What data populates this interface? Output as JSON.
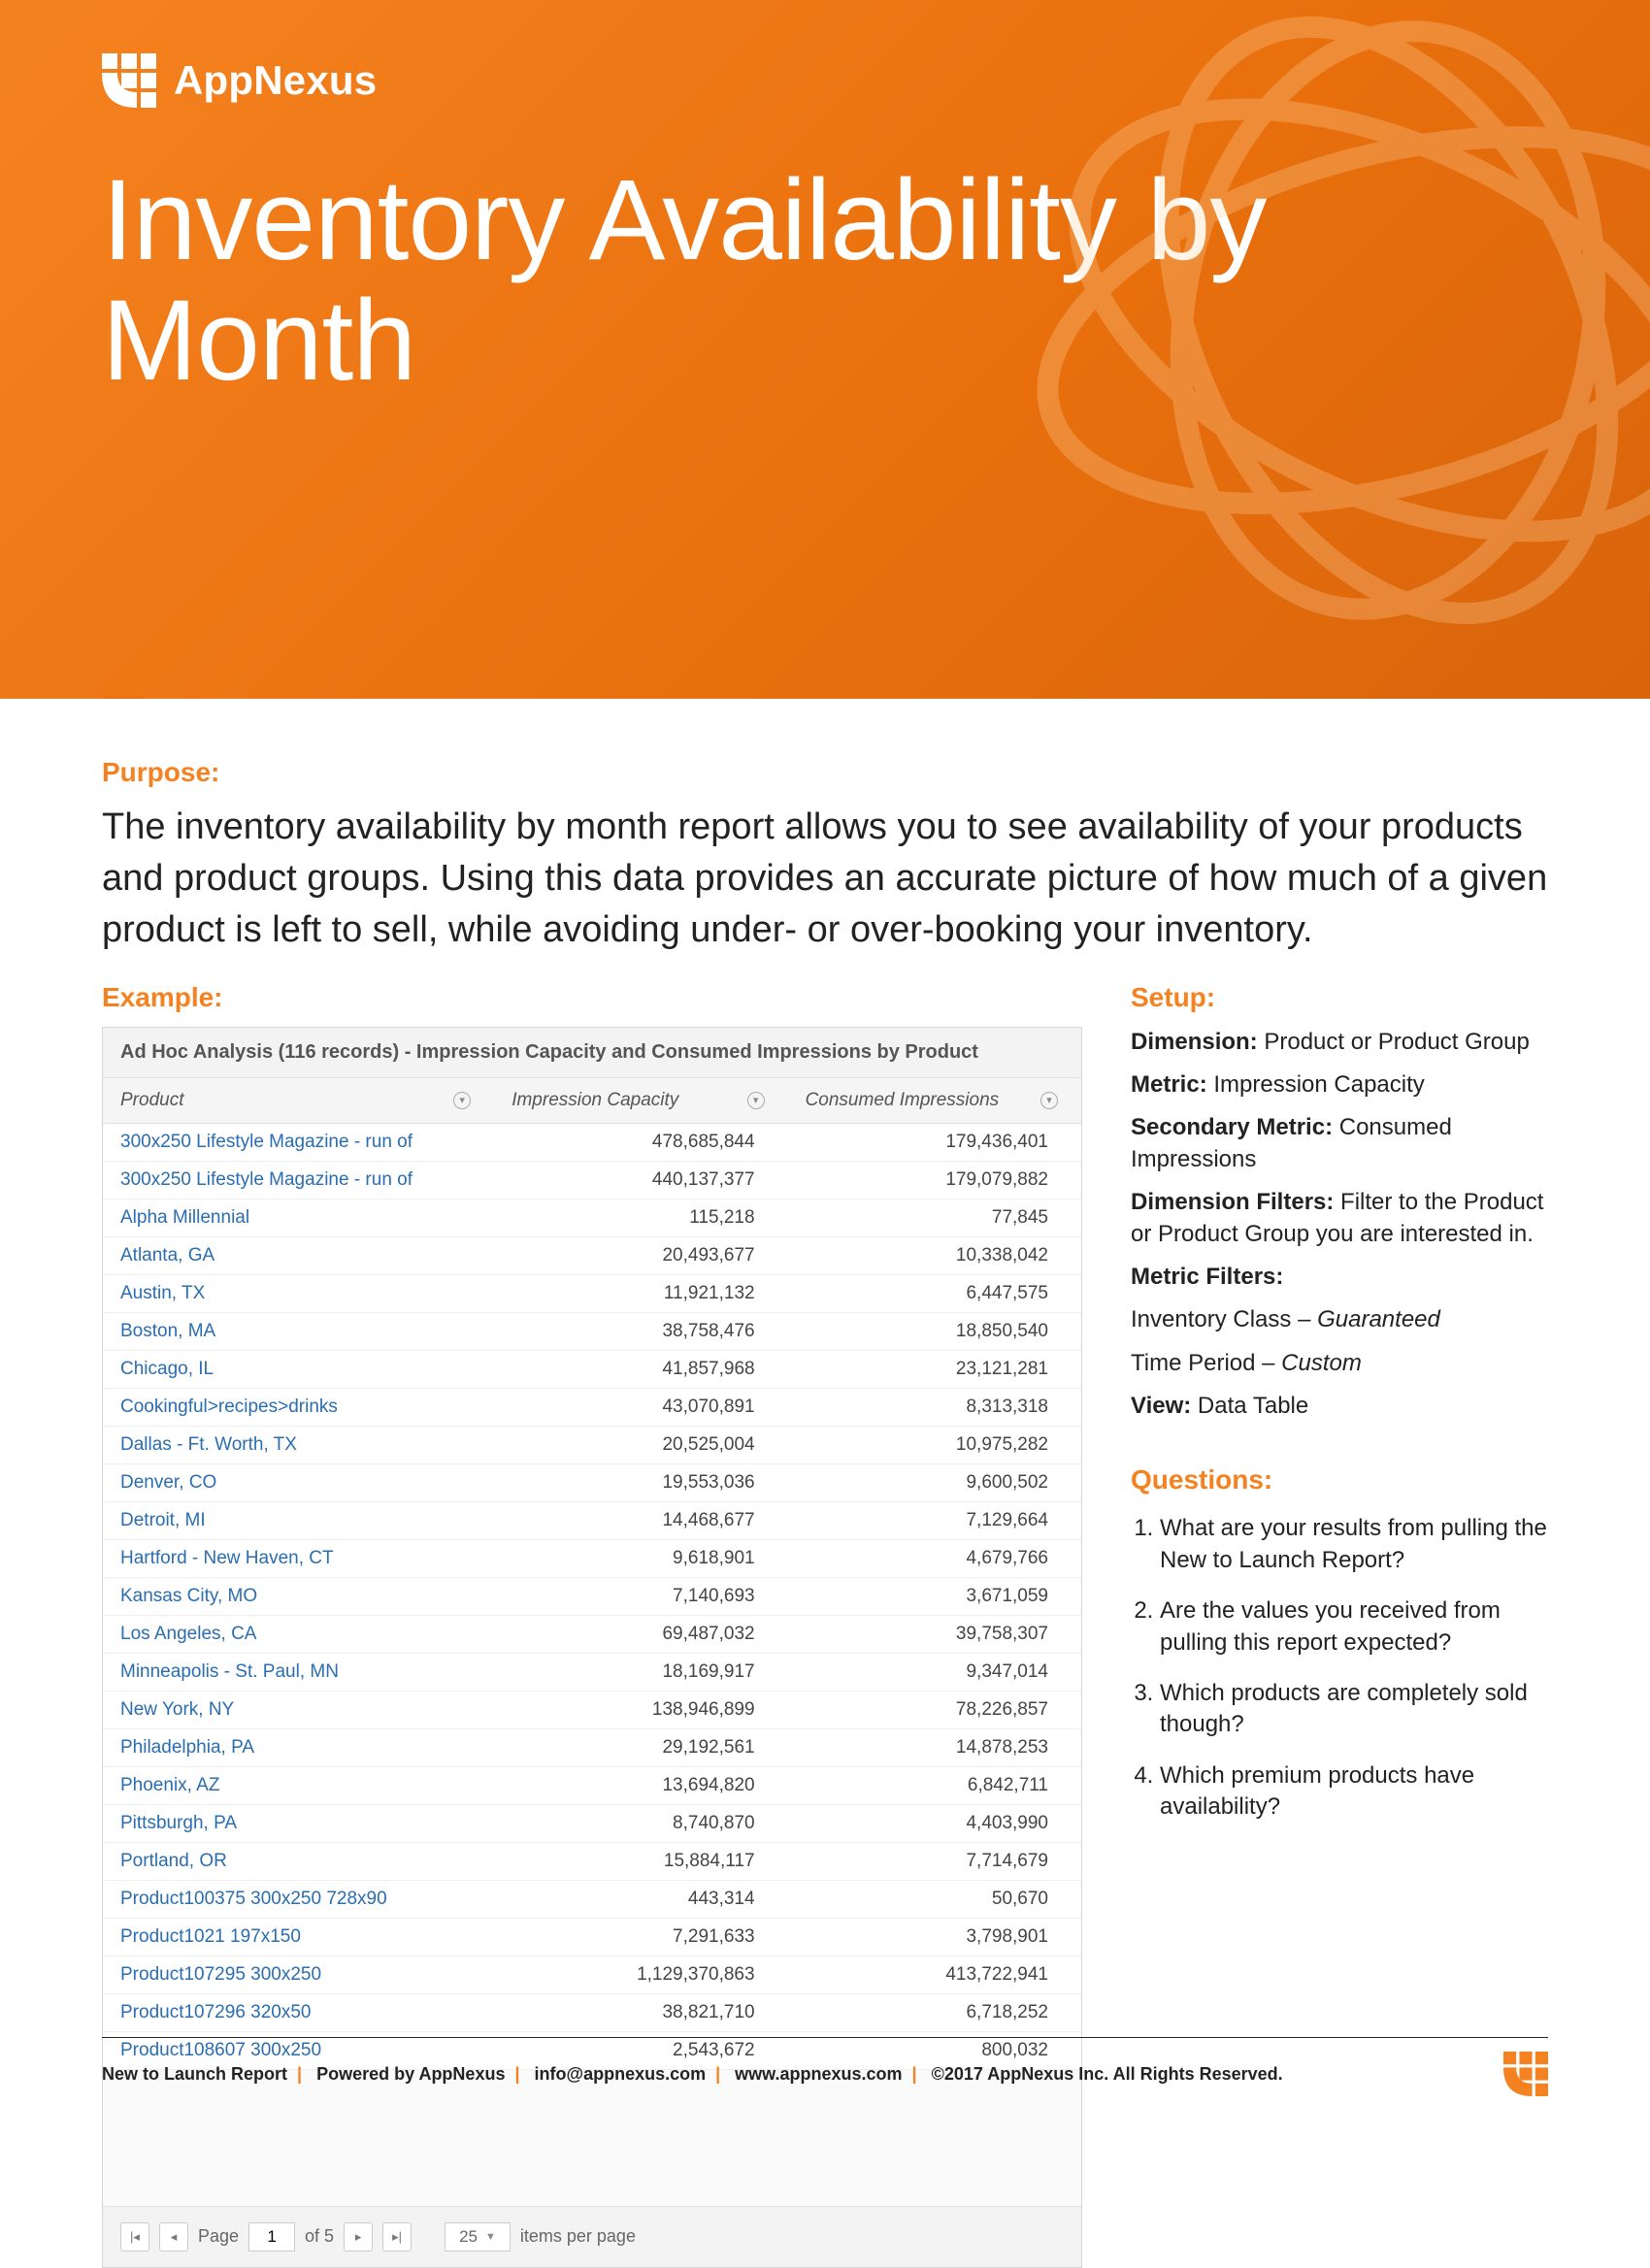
{
  "brand": {
    "name": "AppNexus"
  },
  "title": "Inventory Availability by Month",
  "purpose": {
    "label": "Purpose:",
    "text": "The inventory availability by month report allows you to see availability of your products and product groups. Using this data provides an accurate picture of how much of a given product is left to sell, while avoiding under- or over-booking your inventory."
  },
  "example": {
    "label": "Example:",
    "panel_title": "Ad Hoc Analysis (116 records) - Impression Capacity and Consumed Impressions by Product",
    "columns": {
      "product": "Product",
      "capacity": "Impression Capacity",
      "consumed": "Consumed Impressions"
    },
    "rows": [
      {
        "product": "300x250 Lifestyle Magazine - run of",
        "capacity": "478,685,844",
        "consumed": "179,436,401"
      },
      {
        "product": "300x250 Lifestyle Magazine - run of",
        "capacity": "440,137,377",
        "consumed": "179,079,882"
      },
      {
        "product": "Alpha Millennial",
        "capacity": "115,218",
        "consumed": "77,845"
      },
      {
        "product": "Atlanta, GA",
        "capacity": "20,493,677",
        "consumed": "10,338,042"
      },
      {
        "product": "Austin, TX",
        "capacity": "11,921,132",
        "consumed": "6,447,575"
      },
      {
        "product": "Boston, MA",
        "capacity": "38,758,476",
        "consumed": "18,850,540"
      },
      {
        "product": "Chicago, IL",
        "capacity": "41,857,968",
        "consumed": "23,121,281"
      },
      {
        "product": "Cookingful>recipes>drinks",
        "capacity": "43,070,891",
        "consumed": "8,313,318"
      },
      {
        "product": "Dallas - Ft. Worth, TX",
        "capacity": "20,525,004",
        "consumed": "10,975,282"
      },
      {
        "product": "Denver, CO",
        "capacity": "19,553,036",
        "consumed": "9,600,502"
      },
      {
        "product": "Detroit, MI",
        "capacity": "14,468,677",
        "consumed": "7,129,664"
      },
      {
        "product": "Hartford - New Haven, CT",
        "capacity": "9,618,901",
        "consumed": "4,679,766"
      },
      {
        "product": "Kansas City, MO",
        "capacity": "7,140,693",
        "consumed": "3,671,059"
      },
      {
        "product": "Los Angeles, CA",
        "capacity": "69,487,032",
        "consumed": "39,758,307"
      },
      {
        "product": "Minneapolis - St. Paul, MN",
        "capacity": "18,169,917",
        "consumed": "9,347,014"
      },
      {
        "product": "New York, NY",
        "capacity": "138,946,899",
        "consumed": "78,226,857"
      },
      {
        "product": "Philadelphia, PA",
        "capacity": "29,192,561",
        "consumed": "14,878,253"
      },
      {
        "product": "Phoenix, AZ",
        "capacity": "13,694,820",
        "consumed": "6,842,711"
      },
      {
        "product": "Pittsburgh, PA",
        "capacity": "8,740,870",
        "consumed": "4,403,990"
      },
      {
        "product": "Portland, OR",
        "capacity": "15,884,117",
        "consumed": "7,714,679"
      },
      {
        "product": "Product100375 300x250 728x90",
        "capacity": "443,314",
        "consumed": "50,670"
      },
      {
        "product": "Product1021 197x150",
        "capacity": "7,291,633",
        "consumed": "3,798,901"
      },
      {
        "product": "Product107295 300x250",
        "capacity": "1,129,370,863",
        "consumed": "413,722,941"
      },
      {
        "product": "Product107296 320x50",
        "capacity": "38,821,710",
        "consumed": "6,718,252"
      },
      {
        "product": "Product108607 300x250",
        "capacity": "2,543,672",
        "consumed": "800,032"
      }
    ],
    "pager": {
      "page_label": "Page",
      "page_value": "1",
      "of_label": "of 5",
      "perpage_value": "25",
      "perpage_label": "items per page"
    }
  },
  "setup": {
    "label": "Setup:",
    "dimension_k": "Dimension:",
    "dimension_v": "Product or Product Group",
    "metric_k": "Metric:",
    "metric_v": "Impression Capacity",
    "secmetric_k": "Secondary Metric:",
    "secmetric_v": "Consumed Impressions",
    "dimfilter_k": "Dimension Filters:",
    "dimfilter_v": "Filter to the Product or Product Group you are interested in.",
    "metfilter_k": "Metric Filters:",
    "metfilter_line1_a": "Inventory Class – ",
    "metfilter_line1_b": "Guaranteed",
    "metfilter_line2_a": "Time Period – ",
    "metfilter_line2_b": "Custom",
    "view_k": "View:",
    "view_v": "Data Table"
  },
  "questions": {
    "label": "Questions:",
    "items": [
      "What are your results from pulling the New to Launch Report?",
      "Are the values you received from pulling this report expected?",
      "Which products are completely sold though?",
      "Which premium products have availability?"
    ]
  },
  "footer": {
    "a": "New to Launch Report",
    "b": "Powered by AppNexus",
    "c": "info@appnexus.com",
    "d": "www.appnexus.com",
    "e": "©2017 AppNexus Inc. All Rights Reserved."
  }
}
